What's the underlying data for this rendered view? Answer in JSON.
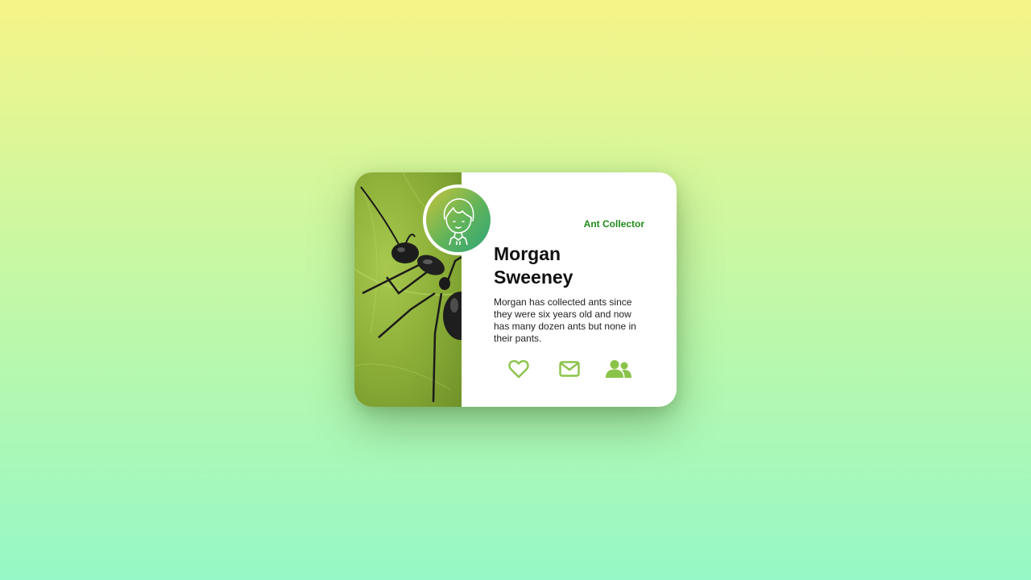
{
  "card": {
    "role": "Ant Collector",
    "name_first": "Morgan",
    "name_last": "Sweeney",
    "bio": "Morgan has collected ants since they were six years old and now has many dozen ants but none in their pants."
  },
  "photo": {
    "icon": "ant-on-leaf-image"
  },
  "avatar": {
    "icon": "person-line-drawing-icon"
  },
  "actions": [
    {
      "icon": "heart-icon"
    },
    {
      "icon": "envelope-icon"
    },
    {
      "icon": "users-icon"
    }
  ],
  "colors": {
    "accent": "#8bc34a",
    "role_text": "#1f8a1a",
    "avatar_gradient_start": "#c7c43c",
    "avatar_gradient_end": "#2fa67a",
    "background_top": "#f6f488",
    "background_bottom": "#96f8c6"
  }
}
